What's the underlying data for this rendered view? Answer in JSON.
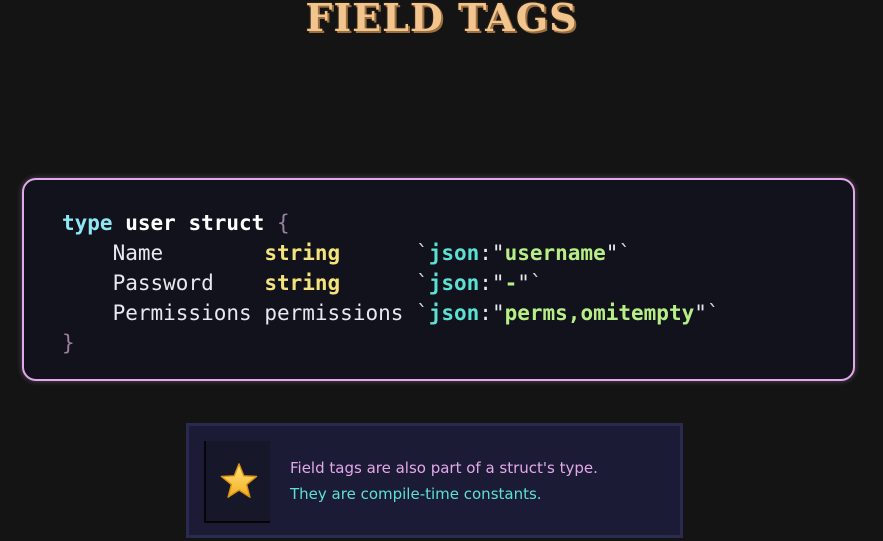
{
  "slide": {
    "title": "FIELD TAGS"
  },
  "code": {
    "line1": {
      "keyword_type": "type",
      "type_name": "user",
      "keyword_struct": "struct",
      "open_brace": "{"
    },
    "fields": [
      {
        "name": "Name",
        "type": "string",
        "tag_open": "`",
        "tag_key": "json",
        "colon": ":",
        "quote_open": "\"",
        "tag_value": "username",
        "quote_close": "\"",
        "tag_close": "`"
      },
      {
        "name": "Password",
        "type": "string",
        "tag_open": "`",
        "tag_key": "json",
        "colon": ":",
        "quote_open": "\"",
        "tag_value": "-",
        "quote_close": "\"",
        "tag_close": "`"
      },
      {
        "name": "Permissions",
        "type": "permissions",
        "tag_open": "`",
        "tag_key": "json",
        "colon": ":",
        "quote_open": "\"",
        "tag_value": "perms,omitempty",
        "quote_close": "\"",
        "tag_close": "`"
      }
    ],
    "close_brace": "}"
  },
  "note": {
    "icon": "star-icon",
    "line1": "Field tags are also part of a struct's type.",
    "line2": "They are compile-time constants."
  },
  "colors": {
    "background": "#141414",
    "title": "#f2c58f",
    "panel_border": "#e3a8e8",
    "keyword": "#8ee7f3",
    "type": "#f4e37a",
    "tag_key": "#5ce0d4",
    "tag_value": "#b7ef86",
    "note_line1": "#e3a8e8",
    "note_line2": "#5ce0d4"
  }
}
